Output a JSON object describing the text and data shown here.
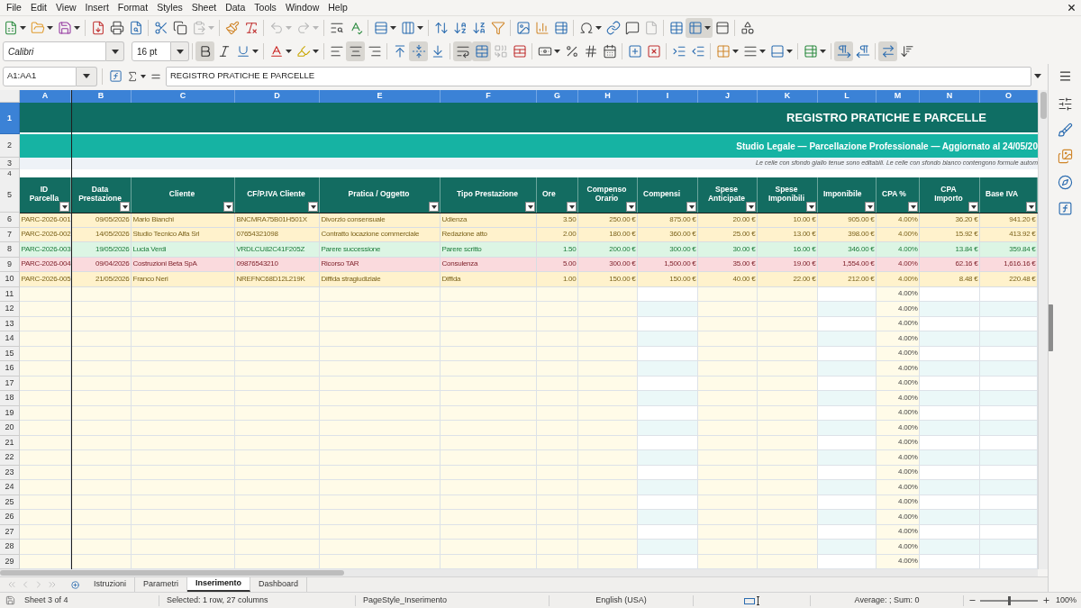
{
  "menu_bar": {
    "items": [
      "File",
      "Edit",
      "View",
      "Insert",
      "Format",
      "Styles",
      "Sheet",
      "Data",
      "Tools",
      "Window",
      "Help"
    ]
  },
  "standard_toolbar": {
    "groups": [
      [
        {
          "kind": "new",
          "menu": true,
          "on": false,
          "disabled": false
        },
        {
          "kind": "open",
          "menu": true,
          "on": false,
          "disabled": false
        },
        {
          "kind": "save",
          "menu": true,
          "on": false,
          "disabled": false
        }
      ],
      [
        {
          "kind": "pdf",
          "menu": false,
          "on": false,
          "disabled": false
        },
        {
          "kind": "print",
          "menu": false,
          "on": false,
          "disabled": false
        },
        {
          "kind": "preview",
          "menu": false,
          "on": false,
          "disabled": false
        }
      ],
      [
        {
          "kind": "cut",
          "menu": false,
          "on": false,
          "disabled": false
        },
        {
          "kind": "copy",
          "menu": false,
          "on": false,
          "disabled": false
        },
        {
          "kind": "paste",
          "menu": true,
          "on": false,
          "disabled": true
        }
      ],
      [
        {
          "kind": "clone",
          "menu": false,
          "on": false,
          "disabled": false
        },
        {
          "kind": "clear",
          "menu": false,
          "on": false,
          "disabled": false
        }
      ],
      [
        {
          "kind": "undo",
          "menu": true,
          "on": false,
          "disabled": true
        },
        {
          "kind": "redo",
          "menu": true,
          "on": false,
          "disabled": true
        }
      ],
      [
        {
          "kind": "find",
          "menu": false,
          "on": false,
          "disabled": false
        },
        {
          "kind": "spelling",
          "menu": false,
          "on": false,
          "disabled": false
        }
      ],
      [
        {
          "kind": "row",
          "menu": true,
          "on": false,
          "disabled": false
        },
        {
          "kind": "column",
          "menu": true,
          "on": false,
          "disabled": false
        }
      ],
      [
        {
          "kind": "sort",
          "menu": false,
          "on": false,
          "disabled": false
        },
        {
          "kind": "sort-asc",
          "menu": false,
          "on": false,
          "disabled": false
        },
        {
          "kind": "sort-desc",
          "menu": false,
          "on": false,
          "disabled": false
        },
        {
          "kind": "filter",
          "menu": false,
          "on": false,
          "disabled": false
        }
      ],
      [
        {
          "kind": "image",
          "menu": false,
          "on": false,
          "disabled": false
        },
        {
          "kind": "chart",
          "menu": false,
          "on": false,
          "disabled": false
        },
        {
          "kind": "pivot",
          "menu": false,
          "on": false,
          "disabled": false
        }
      ],
      [
        {
          "kind": "special",
          "menu": true,
          "on": false,
          "disabled": false
        },
        {
          "kind": "link",
          "menu": false,
          "on": false,
          "disabled": false
        },
        {
          "kind": "comment",
          "menu": false,
          "on": false,
          "disabled": false
        },
        {
          "kind": "header",
          "menu": false,
          "on": false,
          "disabled": true
        }
      ],
      [
        {
          "kind": "print-area",
          "menu": false,
          "on": false,
          "disabled": false
        },
        {
          "kind": "freeze",
          "menu": true,
          "on": true,
          "disabled": false
        },
        {
          "kind": "split",
          "menu": false,
          "on": false,
          "disabled": false
        }
      ],
      [
        {
          "kind": "draw",
          "menu": false,
          "on": false,
          "disabled": false
        }
      ]
    ]
  },
  "formatting_toolbar": {
    "font_name": "Calibri",
    "font_size": "16 pt",
    "groups": [
      [
        {
          "kind": "bold",
          "menu": false,
          "on": true,
          "disabled": false
        },
        {
          "kind": "italic",
          "menu": false,
          "on": false,
          "disabled": false
        },
        {
          "kind": "underline",
          "menu": true,
          "on": false,
          "disabled": false
        }
      ],
      [
        {
          "kind": "font-color",
          "menu": true,
          "on": false,
          "disabled": false
        },
        {
          "kind": "highlight",
          "menu": true,
          "on": false,
          "disabled": false
        }
      ],
      [
        {
          "kind": "align-left",
          "menu": false,
          "on": false,
          "disabled": false
        },
        {
          "kind": "align-center",
          "menu": false,
          "on": true,
          "disabled": false
        },
        {
          "kind": "align-right",
          "menu": false,
          "on": false,
          "disabled": false
        }
      ],
      [
        {
          "kind": "align-top",
          "menu": false,
          "on": false,
          "disabled": false
        },
        {
          "kind": "align-middle",
          "menu": false,
          "on": true,
          "disabled": false
        },
        {
          "kind": "align-bottom",
          "menu": false,
          "on": false,
          "disabled": false
        }
      ],
      [
        {
          "kind": "wrap",
          "menu": false,
          "on": true,
          "disabled": false
        },
        {
          "kind": "merge-center",
          "menu": false,
          "on": true,
          "disabled": false
        },
        {
          "kind": "merge",
          "menu": false,
          "on": false,
          "disabled": true
        },
        {
          "kind": "unmerge",
          "menu": false,
          "on": false,
          "disabled": false
        }
      ],
      [
        {
          "kind": "currency",
          "menu": true,
          "on": false,
          "disabled": false
        },
        {
          "kind": "percent",
          "menu": false,
          "on": false,
          "disabled": false
        },
        {
          "kind": "number",
          "menu": false,
          "on": false,
          "disabled": false
        },
        {
          "kind": "date",
          "menu": false,
          "on": false,
          "disabled": false
        }
      ],
      [
        {
          "kind": "add-decimal",
          "menu": false,
          "on": false,
          "disabled": false
        },
        {
          "kind": "delete-decimal",
          "menu": false,
          "on": false,
          "disabled": false
        }
      ],
      [
        {
          "kind": "indent-more",
          "menu": false,
          "on": false,
          "disabled": false
        },
        {
          "kind": "indent-less",
          "menu": false,
          "on": false,
          "disabled": false
        }
      ],
      [
        {
          "kind": "borders",
          "menu": true,
          "on": false,
          "disabled": false
        },
        {
          "kind": "border-style",
          "menu": true,
          "on": false,
          "disabled": false
        },
        {
          "kind": "border-color",
          "menu": true,
          "on": false,
          "disabled": false
        }
      ],
      [
        {
          "kind": "conditional",
          "menu": true,
          "on": false,
          "disabled": false
        }
      ],
      [
        {
          "kind": "ltr",
          "menu": false,
          "on": true,
          "disabled": false
        },
        {
          "kind": "rtl",
          "menu": false,
          "on": false,
          "disabled": false
        }
      ],
      [
        {
          "kind": "text-ltr",
          "menu": false,
          "on": true,
          "disabled": false
        },
        {
          "kind": "vertical",
          "menu": false,
          "on": false,
          "disabled": false
        }
      ]
    ]
  },
  "formula_bar": {
    "name_box": "A1:AA1",
    "formula": "REGISTRO PRATICHE E PARCELLE"
  },
  "sheet": {
    "column_letters": [
      {
        "label": "A",
        "selected": true
      },
      {
        "label": "B",
        "selected": true
      },
      {
        "label": "C",
        "selected": true
      },
      {
        "label": "D",
        "selected": true
      },
      {
        "label": "E",
        "selected": true
      },
      {
        "label": "F",
        "selected": true
      },
      {
        "label": "G",
        "selected": true
      },
      {
        "label": "H",
        "selected": true
      },
      {
        "label": "I",
        "selected": true
      },
      {
        "label": "J",
        "selected": true
      },
      {
        "label": "K",
        "selected": true
      },
      {
        "label": "L",
        "selected": true
      },
      {
        "label": "M",
        "selected": true
      },
      {
        "label": "N",
        "selected": true
      },
      {
        "label": "O",
        "selected": true
      }
    ],
    "header_rows": [
      {
        "number": "1",
        "selected": true
      },
      {
        "number": "2",
        "selected": false
      },
      {
        "number": "3",
        "selected": false
      },
      {
        "number": "4",
        "selected": false
      },
      {
        "number": "5",
        "selected": false
      }
    ],
    "title": "REGISTRO PRATICHE E PARCELLE",
    "subtitle": "Studio Legale — Parcellazione Professionale — Aggiornato al 24/05/20",
    "note": "Le celle con sfondo giallo tenue sono editabili. Le celle con sfondo bianco contengono formule autom",
    "columns": [
      {
        "header": "ID\nParcella",
        "kind": "input"
      },
      {
        "header": "Data\nPrestazione",
        "kind": "input"
      },
      {
        "header": "Cliente",
        "kind": "input"
      },
      {
        "header": "CF/P.IVA Cliente",
        "kind": "input"
      },
      {
        "header": "Pratica / Oggetto",
        "kind": "input"
      },
      {
        "header": "Tipo Prestazione",
        "kind": "input"
      },
      {
        "header": "Ore",
        "kind": "input"
      },
      {
        "header": "Compenso\nOrario",
        "kind": "input"
      },
      {
        "header": "Compensi",
        "kind": "formula"
      },
      {
        "header": "Spese\nAnticipate",
        "kind": "input"
      },
      {
        "header": "Spese\nImponibili",
        "kind": "input"
      },
      {
        "header": "Imponibile",
        "kind": "formula"
      },
      {
        "header": "CPA %",
        "kind": "input"
      },
      {
        "header": "CPA\nImporto",
        "kind": "formula"
      },
      {
        "header": "Base IVA",
        "kind": "formula"
      }
    ],
    "rows": [
      {
        "number": "6",
        "selected": false,
        "color": "#fff2cc",
        "cells": [
          "PARC-2026-001",
          "09/05/2026",
          "Mario Bianchi",
          "BNCMRA75B01H501X",
          "Divorzio consensuale",
          "Udienza",
          "3.50",
          "250.00 €",
          "875.00 €",
          "20.00 €",
          "10.00 €",
          "905.00 €",
          "4.00%",
          "36.20 €",
          "941.20 €"
        ]
      },
      {
        "number": "7",
        "selected": false,
        "color": "#fff2cc",
        "cells": [
          "PARC-2026-002",
          "14/05/2026",
          "Studio Tecnico Alfa Srl",
          "07654321098",
          "Contratto locazione commerciale",
          "Redazione atto",
          "2.00",
          "180.00 €",
          "360.00 €",
          "25.00 €",
          "13.00 €",
          "398.00 €",
          "4.00%",
          "15.92 €",
          "413.92 €"
        ]
      },
      {
        "number": "8",
        "selected": false,
        "color": "#dcf5e4",
        "cells": [
          "PARC-2026-003",
          "19/05/2026",
          "Lucia Verdi",
          "VRDLCU82C41F205Z",
          "Parere successione",
          "Parere scritto",
          "1.50",
          "200.00 €",
          "300.00 €",
          "30.00 €",
          "16.00 €",
          "346.00 €",
          "4.00%",
          "13.84 €",
          "359.84 €"
        ]
      },
      {
        "number": "9",
        "selected": false,
        "color": "#fadadd",
        "cells": [
          "PARC-2026-004",
          "09/04/2026",
          "Costruzioni Beta SpA",
          "09876543210",
          "Ricorso TAR",
          "Consulenza",
          "5.00",
          "300.00 €",
          "1,500.00 €",
          "35.00 €",
          "19.00 €",
          "1,554.00 €",
          "4.00%",
          "62.16 €",
          "1,616.16 €"
        ]
      },
      {
        "number": "10",
        "selected": false,
        "color": "#fff2cc",
        "cells": [
          "PARC-2026-005",
          "21/05/2026",
          "Franco Neri",
          "NREFNC68D12L219K",
          "Diffida stragiudiziale",
          "Diffida",
          "1.00",
          "150.00 €",
          "150.00 €",
          "40.00 €",
          "22.00 €",
          "212.00 €",
          "4.00%",
          "8.48 €",
          "220.48 €"
        ]
      }
    ],
    "blank_rows": [
      {
        "number": "11",
        "selected": false,
        "cpa_percent": "4.00%"
      },
      {
        "number": "12",
        "selected": false,
        "cpa_percent": "4.00%"
      },
      {
        "number": "13",
        "selected": false,
        "cpa_percent": "4.00%"
      },
      {
        "number": "14",
        "selected": false,
        "cpa_percent": "4.00%"
      },
      {
        "number": "15",
        "selected": false,
        "cpa_percent": "4.00%"
      },
      {
        "number": "16",
        "selected": false,
        "cpa_percent": "4.00%"
      },
      {
        "number": "17",
        "selected": false,
        "cpa_percent": "4.00%"
      },
      {
        "number": "18",
        "selected": false,
        "cpa_percent": "4.00%"
      },
      {
        "number": "19",
        "selected": false,
        "cpa_percent": "4.00%"
      },
      {
        "number": "20",
        "selected": false,
        "cpa_percent": "4.00%"
      },
      {
        "number": "21",
        "selected": false,
        "cpa_percent": "4.00%"
      },
      {
        "number": "22",
        "selected": false,
        "cpa_percent": "4.00%"
      },
      {
        "number": "23",
        "selected": false,
        "cpa_percent": "4.00%"
      },
      {
        "number": "24",
        "selected": false,
        "cpa_percent": "4.00%"
      },
      {
        "number": "25",
        "selected": false,
        "cpa_percent": "4.00%"
      },
      {
        "number": "26",
        "selected": false,
        "cpa_percent": "4.00%"
      },
      {
        "number": "27",
        "selected": false,
        "cpa_percent": "4.00%"
      },
      {
        "number": "28",
        "selected": false,
        "cpa_percent": "4.00%"
      },
      {
        "number": "29",
        "selected": false,
        "cpa_percent": "4.00%"
      }
    ]
  },
  "sheet_tabs": {
    "navigation": [
      {
        "kind": "first",
        "disabled": true
      },
      {
        "kind": "previous",
        "disabled": true
      },
      {
        "kind": "next",
        "disabled": true
      },
      {
        "kind": "last",
        "disabled": true
      }
    ],
    "tabs": [
      {
        "label": "Istruzioni",
        "selected": false
      },
      {
        "label": "Parametri",
        "selected": false
      },
      {
        "label": "Inserimento",
        "selected": true
      },
      {
        "label": "Dashboard",
        "selected": false
      }
    ]
  },
  "status_bar": {
    "sheet": "Sheet 3 of 4",
    "selection": "Selected: 1 row, 27 columns",
    "page_style": "PageStyle_Inserimento",
    "language": "English (USA)",
    "summary": "Average: ; Sum: 0",
    "zoom": {
      "level": 0.5,
      "reading": "100%"
    }
  }
}
